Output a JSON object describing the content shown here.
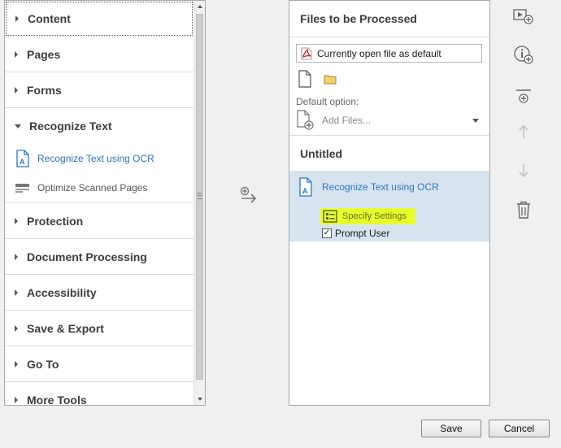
{
  "tools_panel": {
    "categories_top": [
      {
        "label": "Content"
      },
      {
        "label": "Pages"
      },
      {
        "label": "Forms"
      }
    ],
    "expanded": {
      "label": "Recognize Text",
      "subtools": [
        {
          "label": "Recognize Text using OCR",
          "icon": "ocr-document-icon"
        },
        {
          "label": "Optimize Scanned Pages",
          "icon": "scanner-icon"
        }
      ]
    },
    "categories_bottom": [
      {
        "label": "Protection"
      },
      {
        "label": "Document Processing"
      },
      {
        "label": "Accessibility"
      },
      {
        "label": "Save & Export"
      },
      {
        "label": "Go To"
      },
      {
        "label": "More Tools"
      }
    ]
  },
  "files_panel": {
    "title": "Files to be Processed",
    "file_select_value": "Currently open file as default",
    "default_option_label": "Default option:",
    "add_files_label": "Add Files...",
    "sequence_title": "Untitled",
    "action": {
      "label": "Recognize Text using OCR",
      "specify_label": "Specify Settings",
      "prompt_label": "Prompt User",
      "prompt_checked": true
    }
  },
  "buttons": {
    "save": "Save",
    "cancel": "Cancel"
  },
  "colors": {
    "accent_blue": "#2d74c4",
    "highlight_yellow": "#e8ff2b",
    "selection_bg": "#d7e4ef"
  }
}
